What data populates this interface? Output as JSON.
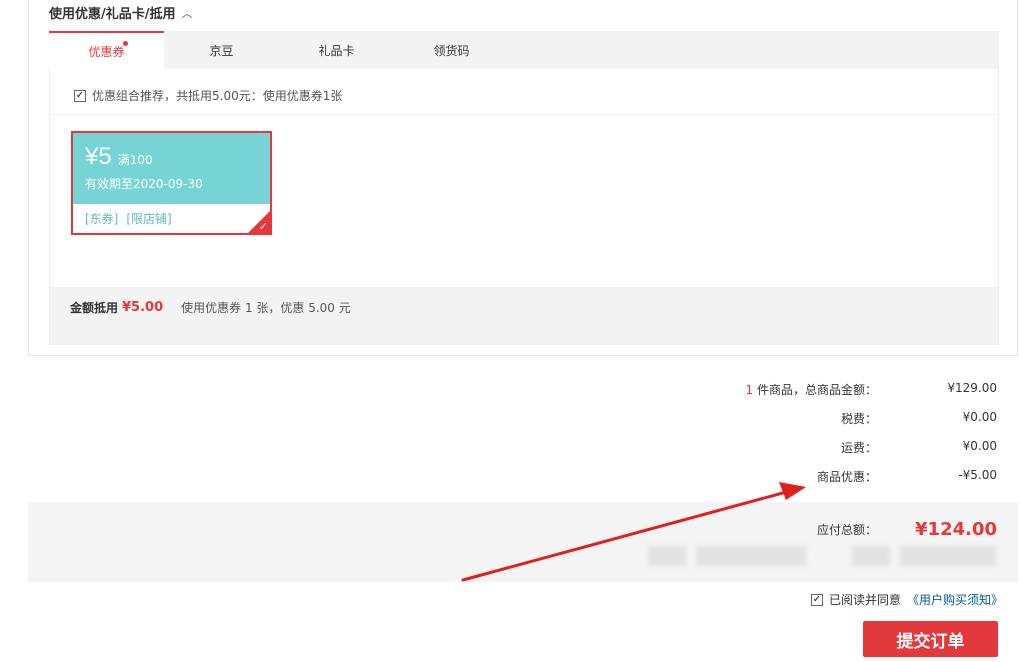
{
  "section": {
    "title": "使用优惠/礼品卡/抵用"
  },
  "tabs": [
    {
      "label": "优惠券",
      "active": true
    },
    {
      "label": "京豆",
      "active": false
    },
    {
      "label": "礼品卡",
      "active": false
    },
    {
      "label": "领货码",
      "active": false
    }
  ],
  "recommend": {
    "checked": true,
    "text": "优惠组合推荐，共抵用5.00元：使用优惠券1张"
  },
  "coupon": {
    "amount": "¥5",
    "condition": "满100",
    "validity": "有效期至2020-09-30",
    "tags": [
      "[东券]",
      "[限店铺]"
    ],
    "selected": true
  },
  "summary": {
    "label": "金额抵用",
    "amount": "¥5.00",
    "detail": "使用优惠券 1 张，优惠 5.00 元"
  },
  "prices": {
    "items_count": "1",
    "items_label": " 件商品，总商品金额：",
    "items_value": "¥129.00",
    "tax_label": "税费：",
    "tax_value": "¥0.00",
    "shipping_label": "运费：",
    "shipping_value": "¥0.00",
    "discount_label": "商品优惠：",
    "discount_value": "-¥5.00"
  },
  "total": {
    "label": "应付总额：",
    "value": "¥124.00"
  },
  "agreement": {
    "checked": true,
    "text": "已阅读并同意",
    "link": "《用户购买须知》"
  },
  "submit": {
    "label": "提交订单"
  },
  "colors": {
    "accent": "#e4393c",
    "coupon_bg": "#76d4d4",
    "link": "#005aa0",
    "annotation_arrow": "#e0201f"
  }
}
